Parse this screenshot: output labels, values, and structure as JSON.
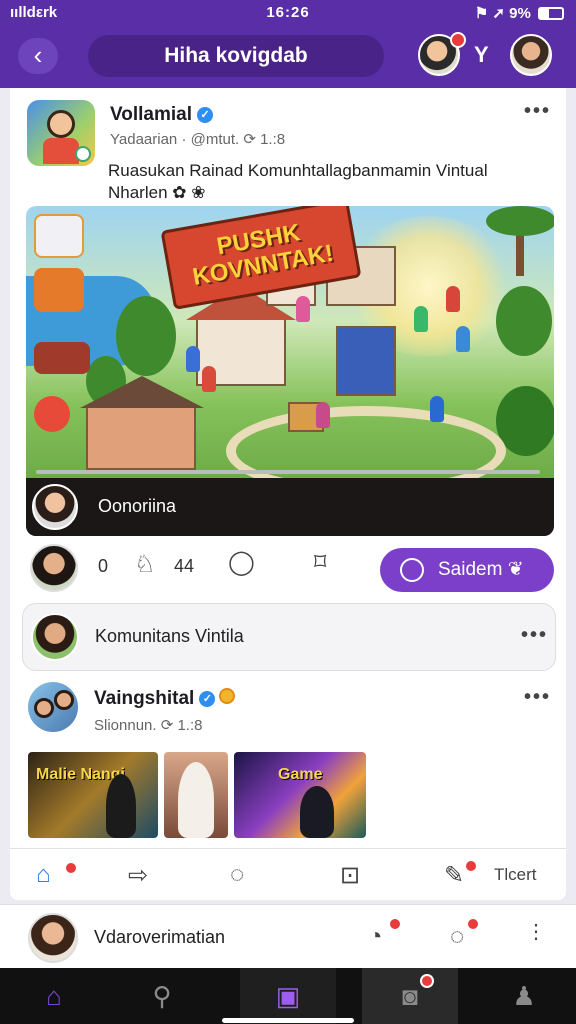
{
  "status": {
    "carrier": "ıılldεrk",
    "time": "16:26",
    "battery": "9%"
  },
  "header": {
    "title": "Hiha kovigdab",
    "extra_glyph": "Y"
  },
  "post1": {
    "name": "Vollamial",
    "meta": "Yadaarian · @mtut. ⟳ 1.:8",
    "text": "Ruasukan Rainad Komunhtallagbanmamin Vintual Nharlen",
    "hero_banner": "PUSHK KOVNNTAK!",
    "video_caption": "Oonoriina",
    "comments_count": "0",
    "likes_count": "44",
    "send_label": "Saidem"
  },
  "community_row": {
    "label": "Komunitans Vintila"
  },
  "post2": {
    "name": "Vaingshital",
    "meta": "Slionnun. ⟳ 1.:8",
    "thumb1_text": "Malie Nangi",
    "thumb3_text": "Game"
  },
  "post_tabs": {
    "last_label": "Tlcert"
  },
  "userbar": {
    "label": "Vdaroverimatian"
  },
  "icons": {
    "back": "back-arrow-icon",
    "like": "thumbs-up-icon",
    "comment": "chat-bubble-icon",
    "save": "bookmark-icon",
    "home": "home-icon",
    "search": "search-icon",
    "create": "camera-icon",
    "profile": "user-icon"
  },
  "colors": {
    "brand": "#5a2ea6",
    "accent": "#7b3fc9",
    "badge": "#e83b3b",
    "link": "#2f7fe0"
  }
}
